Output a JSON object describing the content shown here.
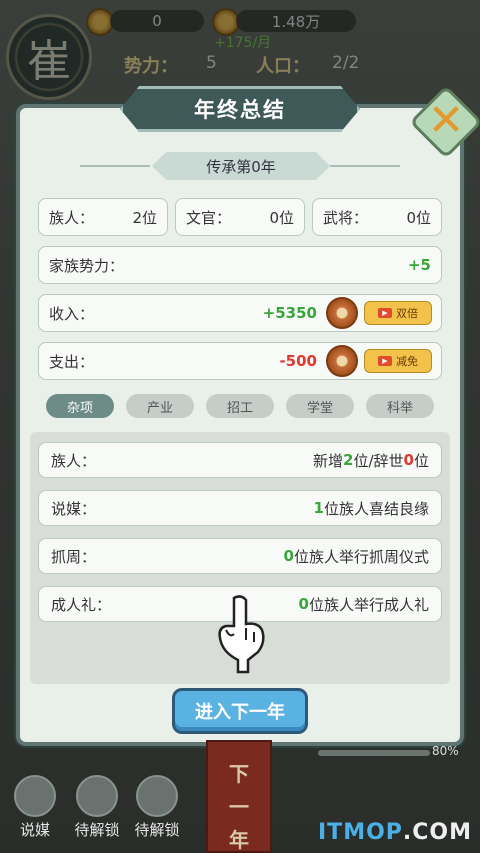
{
  "top": {
    "clan_char": "崔",
    "res1": "0",
    "res2": "1.48万",
    "monthly": "+175/月",
    "power_label": "势力：",
    "power_value": "5",
    "pop_label": "人口：",
    "pop_value": "2/2"
  },
  "dialog": {
    "title": "年终总结",
    "subtitle": "传承第0年",
    "stats": [
      {
        "label": "族人：",
        "value": "2位"
      },
      {
        "label": "文官：",
        "value": "0位"
      },
      {
        "label": "武将：",
        "value": "0位"
      }
    ],
    "power": {
      "label": "家族势力：",
      "value": "+5"
    },
    "income": {
      "label": "收入：",
      "value": "+5350",
      "btn": "双倍"
    },
    "expense": {
      "label": "支出：",
      "value": "-500",
      "btn": "减免"
    },
    "tabs": [
      "杂项",
      "产业",
      "招工",
      "学堂",
      "科举"
    ],
    "rows": {
      "r1": {
        "label": "族人：",
        "a": "新增",
        "b": "2",
        "c": "位/辞世",
        "d": "0",
        "e": "位"
      },
      "r2": {
        "label": "说媒：",
        "a": "1",
        "b": "位族人喜结良缘"
      },
      "r3": {
        "label": "抓周：",
        "a": "0",
        "b": "位族人举行抓周仪式"
      },
      "r4": {
        "label": "成人礼：",
        "a": "0",
        "b": "位族人举行成人礼"
      }
    },
    "next_btn": "进入下一年"
  },
  "bottom": {
    "items": [
      "说媒",
      "待解锁",
      "待解锁"
    ],
    "banner": [
      "下",
      "一",
      "年"
    ],
    "zoom": "80%"
  },
  "watermark": {
    "a": "ITMOP",
    "b": ".COM"
  }
}
